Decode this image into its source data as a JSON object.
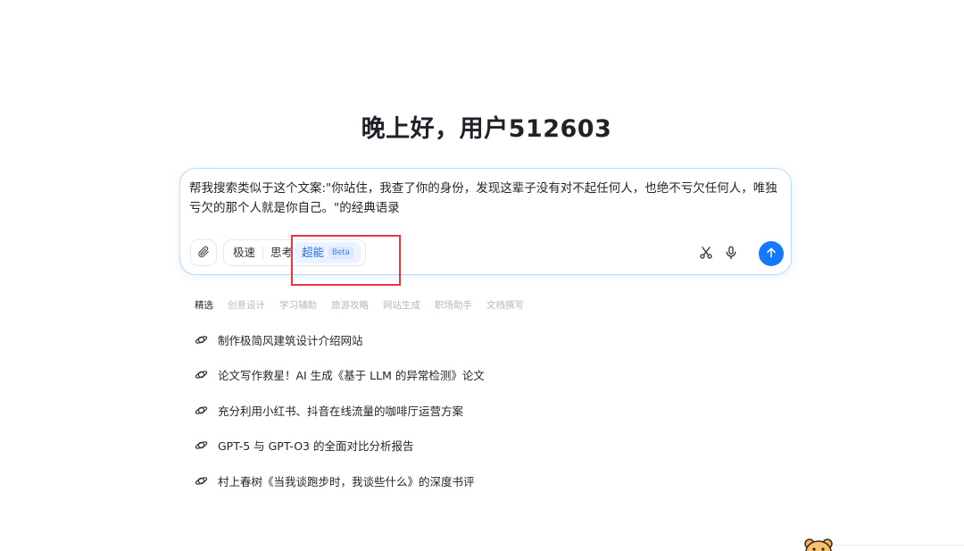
{
  "greeting": "晚上好，用户512603",
  "composer": {
    "prompt": "帮我搜索类似于这个文案:\"你站住，我查了你的身份，发现这辈子没有对不起任何人，也绝不亏欠任何人，唯独亏欠的那个人就是你自己。\"的经典语录",
    "modes": [
      {
        "label": "极速"
      },
      {
        "label": "思考"
      },
      {
        "label": "超能",
        "badge": "Beta"
      }
    ],
    "active_mode": "超能"
  },
  "categories": [
    "精选",
    "创意设计",
    "学习辅助",
    "旅游攻略",
    "网站生成",
    "职场助手",
    "文档撰写"
  ],
  "suggestions": [
    "制作极简风建筑设计介绍网站",
    "论文写作救星！AI 生成《基于 LLM 的异常检测》论文",
    "充分利用小红书、抖音在线流量的咖啡厅运营方案",
    "GPT-5 与 GPT-O3 的全面对比分析报告",
    "村上春树《当我谈跑步时，我谈些什么》的深度书评"
  ],
  "colors": {
    "accent": "#1677ff",
    "highlight": "#e8373d",
    "muted_text": "#b4b8bf"
  },
  "icons": {
    "attach": "paperclip-icon",
    "scissors": "scissors-icon",
    "mic": "microphone-icon",
    "send": "arrow-up-icon",
    "suggestion": "planet-icon"
  }
}
